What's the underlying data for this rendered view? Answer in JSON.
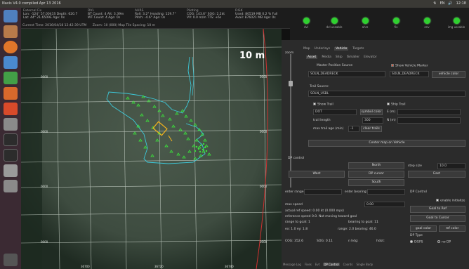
{
  "topbar": {
    "title": "Navis V4.0 compiled Apr 13 2016",
    "tray": [
      "⇅",
      "EN",
      "🔊",
      "12:18"
    ]
  },
  "launcher": {
    "items": [
      {
        "name": "ubuntu-dash-icon",
        "color": "#4f7fbf"
      },
      {
        "name": "files-icon",
        "color": "#b87a4a"
      },
      {
        "name": "firefox-icon",
        "color": "#e0762a"
      },
      {
        "name": "document-icon",
        "color": "#4a8ad0"
      },
      {
        "name": "spreadsheet-icon",
        "color": "#43a047"
      },
      {
        "name": "presentation-icon",
        "color": "#d8692c"
      },
      {
        "name": "software-center-icon",
        "color": "#d84a2a"
      },
      {
        "name": "settings-icon",
        "color": "#8a8a8a"
      },
      {
        "name": "terminal-icon",
        "color": "#2c2c2c"
      },
      {
        "name": "terminal-2-icon",
        "color": "#2c2c2c"
      },
      {
        "name": "text-editor-icon",
        "color": "#9a9a9a"
      },
      {
        "name": "archive-icon",
        "color": "#8a8a8a"
      },
      {
        "name": "trash-icon",
        "color": "#555"
      }
    ]
  },
  "status": {
    "external_fix": {
      "header": "External Fix",
      "line1": "Lon: -124° 57.0041S  Depth: 620.7",
      "line2": "Lat: 44° 21.6509E  Age: 0s"
    },
    "dvl": {
      "header": "DVL",
      "line1": "BT Count: 4  Alt: 3.39m",
      "line2": "WT Count: 4  Age: 0s"
    },
    "ahrs": {
      "header": "AHRS",
      "line1": "Roll: 3.2°  Heading: 129.7°",
      "line2": "Pitch: -4.6°  Age: 0s"
    },
    "piloting": {
      "header": "Piloting",
      "line1": "COG: 143.6°  SOG: 2.2kt",
      "line2": "VV: 0.0 m/m  TTS: +6s"
    },
    "disk": {
      "header": "DISK",
      "line1": "Used: 80519 MB  0.2 % Full",
      "line2": "Avail: 876021 MB  Age: 0s"
    },
    "current_time": "Current Time:   2016/04/18 12:42:39 UTM",
    "zoom_info": "Zoom: 10 (000)  Map Tile Spacing: 10 m"
  },
  "map": {
    "scale_label": "10 m",
    "grid_labels": [
      "0000",
      "0000",
      "0000",
      "0000",
      "0000",
      "0000",
      "0000",
      "0000",
      "0000",
      "0000",
      "0000"
    ],
    "bottom_labels": [
      "36700",
      "36720",
      "36740"
    ]
  },
  "indicators": [
    {
      "label": "dvl"
    },
    {
      "label": "dvl useable"
    },
    {
      "label": "ahrs"
    },
    {
      "label": "fix"
    },
    {
      "label": "env"
    },
    {
      "label": "img useable"
    }
  ],
  "panel": {
    "zoom_label": "zoom",
    "tabs": [
      "Map",
      "Underlays",
      "Vehicle",
      "Targets"
    ],
    "subtabs": [
      "Asset",
      "Media",
      "Ship",
      "ISmaller",
      "Elevator"
    ],
    "master_position_source_label": "Master Position Source",
    "master_position_source_value": "SOLN_DEADRECK",
    "show_vehicle_marker_label": "Show Vehicle Marker",
    "vehicle_marker_value": "SOLN_DEADRECK",
    "vehicle_color_button": "vehicle color",
    "trail_source_label": "Trail Source:",
    "trail_source_value": "SOLN_USBL",
    "show_trail_label": "Show Trail",
    "ship_trail_label": "Ship Trail",
    "symbol_value": "DOT",
    "symbol_color_button": "symbol color",
    "e_label": "E (m)",
    "trail_length_label": "trail length",
    "trail_length_value": "300",
    "n_label": "N (m)",
    "max_trail_age_label": "max trail age (min)",
    "max_trail_age_value": "-1",
    "clear_trails_button": "clear trails",
    "center_button": "Center map on Vehicle",
    "dp_control_label": "DP control",
    "north_button": "North",
    "step_size_label": "step size",
    "step_size_value": "10.0",
    "west_button": "West",
    "dp_cursor_button": "DP cursor",
    "east_button": "East",
    "south_button": "South",
    "enter_range_label": "enter range:",
    "enter_bearing_label": "enter bearing:",
    "dp_control_label2": "DP Control",
    "enable_initialize_label": "enable initialize",
    "max_speed_label": "max speed",
    "max_speed_value": "0.00",
    "goal_to_ref_button": "Goal to Ref",
    "goal_to_cursor_button": "Goal to Cursor",
    "actual_ref_speed": "actual ref speed: 0.00 kt (0.000 mps)",
    "ref_speed_msg": "reference speed 0.0. Not moving toward goal",
    "range_to_goal": "range to goal: 1",
    "bearing_to_goal": "bearing to goal: 11",
    "goal_color_button": "goal color",
    "ref_color_button": "ref color",
    "ex_ey": "ex: 1.0  ey: 1.8",
    "range_bearing": "range: 2.0  bearing: 46.0",
    "dp_type_label": "DP Type",
    "cog": "COG: 352.6",
    "sog": "SOG: 0.11",
    "n_hdg": "n hdg:",
    "hdot": "hdot:",
    "dp_type_options": [
      "DGPS",
      "no DP"
    ],
    "bottom_tabs": [
      "Message Log",
      "Fixes",
      "Evt",
      "DP Control",
      "Coords",
      "Single Body"
    ]
  }
}
